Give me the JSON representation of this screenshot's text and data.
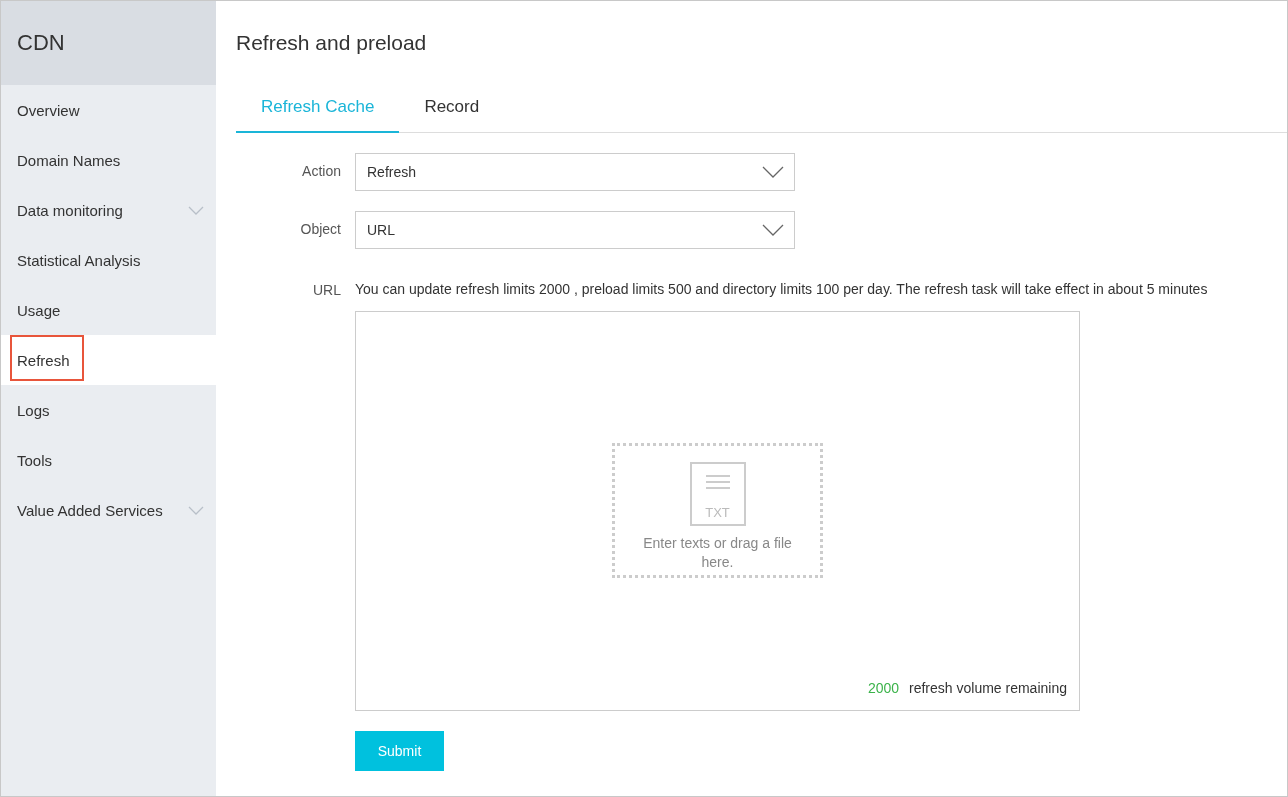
{
  "sidebar": {
    "title": "CDN",
    "items": [
      {
        "label": "Overview",
        "kind": "link",
        "selected": false,
        "highlighted": false
      },
      {
        "label": "Domain Names",
        "kind": "link",
        "selected": false,
        "highlighted": false
      },
      {
        "label": "Data monitoring",
        "kind": "group",
        "selected": false,
        "highlighted": false
      },
      {
        "label": "Statistical Analysis",
        "kind": "link",
        "selected": false,
        "highlighted": false
      },
      {
        "label": "Usage",
        "kind": "link",
        "selected": false,
        "highlighted": false
      },
      {
        "label": "Refresh",
        "kind": "link",
        "selected": true,
        "highlighted": true
      },
      {
        "label": "Logs",
        "kind": "link",
        "selected": false,
        "highlighted": false
      },
      {
        "label": "Tools",
        "kind": "link",
        "selected": false,
        "highlighted": false
      },
      {
        "label": "Value Added Services",
        "kind": "group",
        "selected": false,
        "highlighted": false
      }
    ]
  },
  "page": {
    "title": "Refresh and preload"
  },
  "tabs": [
    {
      "label": "Refresh Cache",
      "selected": true
    },
    {
      "label": "Record",
      "selected": false
    }
  ],
  "form": {
    "action": {
      "label": "Action",
      "value": "Refresh"
    },
    "object": {
      "label": "Object",
      "value": "URL"
    },
    "url": {
      "label": "URL",
      "hint": "You can update refresh limits 2000 , preload limits 500 and directory limits 100 per day. The refresh task will take effect in about 5 minutes",
      "drop_badge": "TXT",
      "drop_text": "Enter texts or drag a file here.",
      "remaining_count": "2000",
      "remaining_label": "refresh volume remaining"
    },
    "submit": "Submit"
  }
}
